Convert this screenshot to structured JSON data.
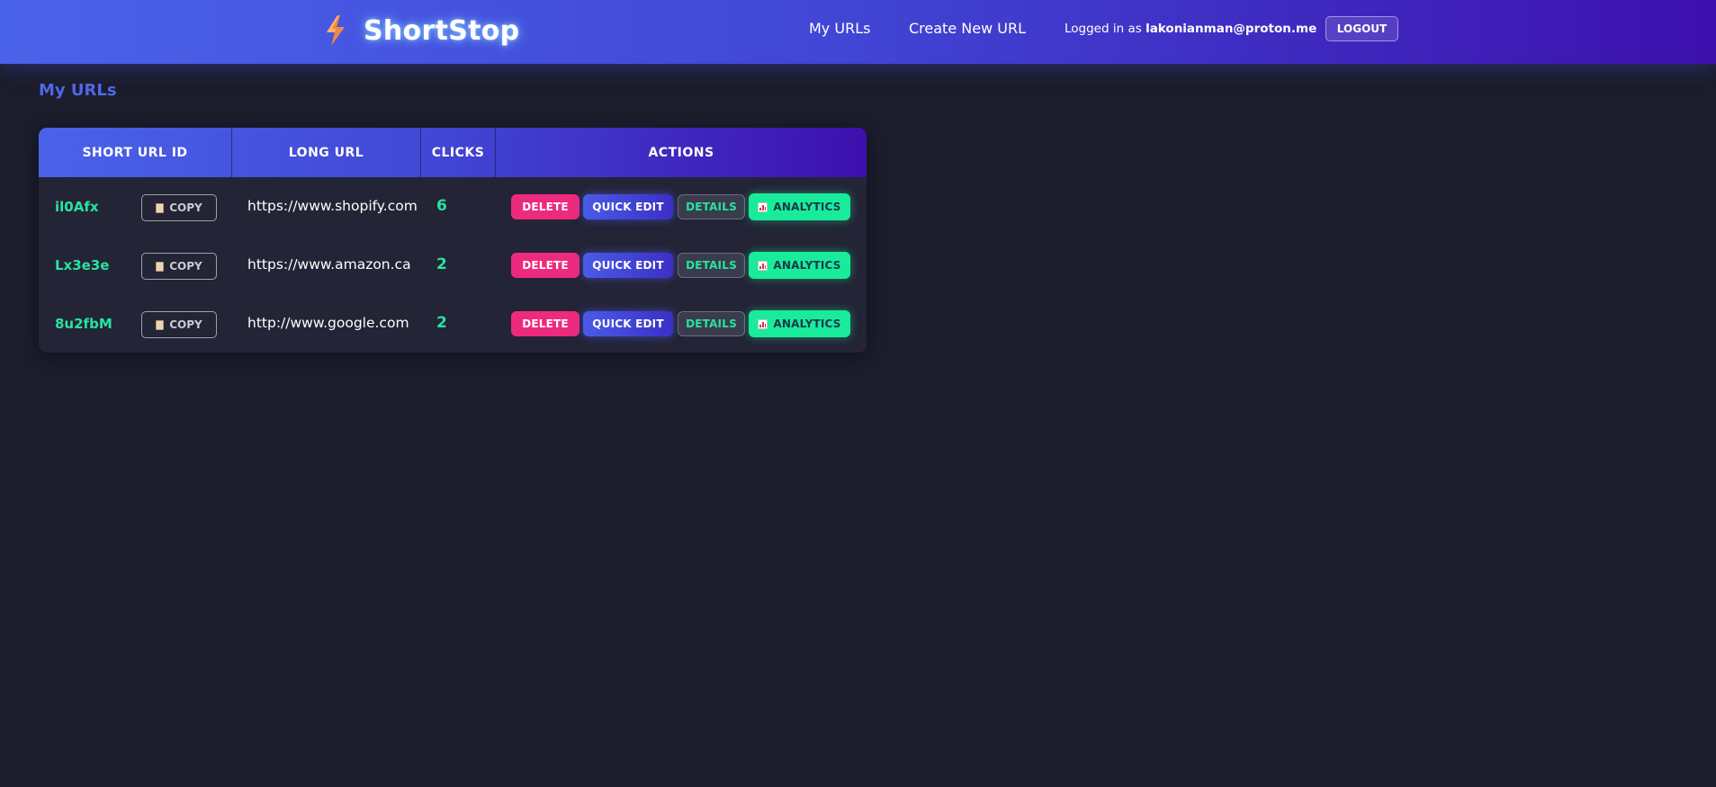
{
  "app": {
    "brand": "ShortStop",
    "brand_icon": "lightning-bolt-icon",
    "accent_gradient": [
      "#4a62e9",
      "#3d10ad"
    ]
  },
  "nav": {
    "my_urls": "My URLs",
    "create_new": "Create New URL",
    "logged_in_prefix": "Logged in as",
    "user_email": "lakonianman@proton.me",
    "logout_label": "LOGOUT"
  },
  "page": {
    "title": "My URLs"
  },
  "table": {
    "headers": {
      "short_id": "SHORT URL ID",
      "long_url": "LONG URL",
      "clicks": "CLICKS",
      "actions": "ACTIONS"
    },
    "rows": [
      {
        "short_id": "il0Afx",
        "long_url": "https://www.shopify.com",
        "clicks": "6"
      },
      {
        "short_id": "Lx3e3e",
        "long_url": "https://www.amazon.ca",
        "clicks": "2"
      },
      {
        "short_id": "8u2fbM",
        "long_url": "http://www.google.com",
        "clicks": "2"
      }
    ],
    "buttons": {
      "copy": "COPY",
      "delete": "DELETE",
      "quick_edit": "QUICK EDIT",
      "details": "DETAILS",
      "analytics": "ANALYTICS"
    },
    "icons": {
      "copy": "clipboard-icon",
      "analytics": "bar-chart-icon"
    }
  },
  "colors": {
    "background": "#1b1c2c",
    "table_bg": "#232436",
    "id_green": "#27e3a0",
    "delete_pink": "#ee2a7e",
    "analytics_green": "#18ec9a",
    "title_blue": "#4f68e6"
  }
}
